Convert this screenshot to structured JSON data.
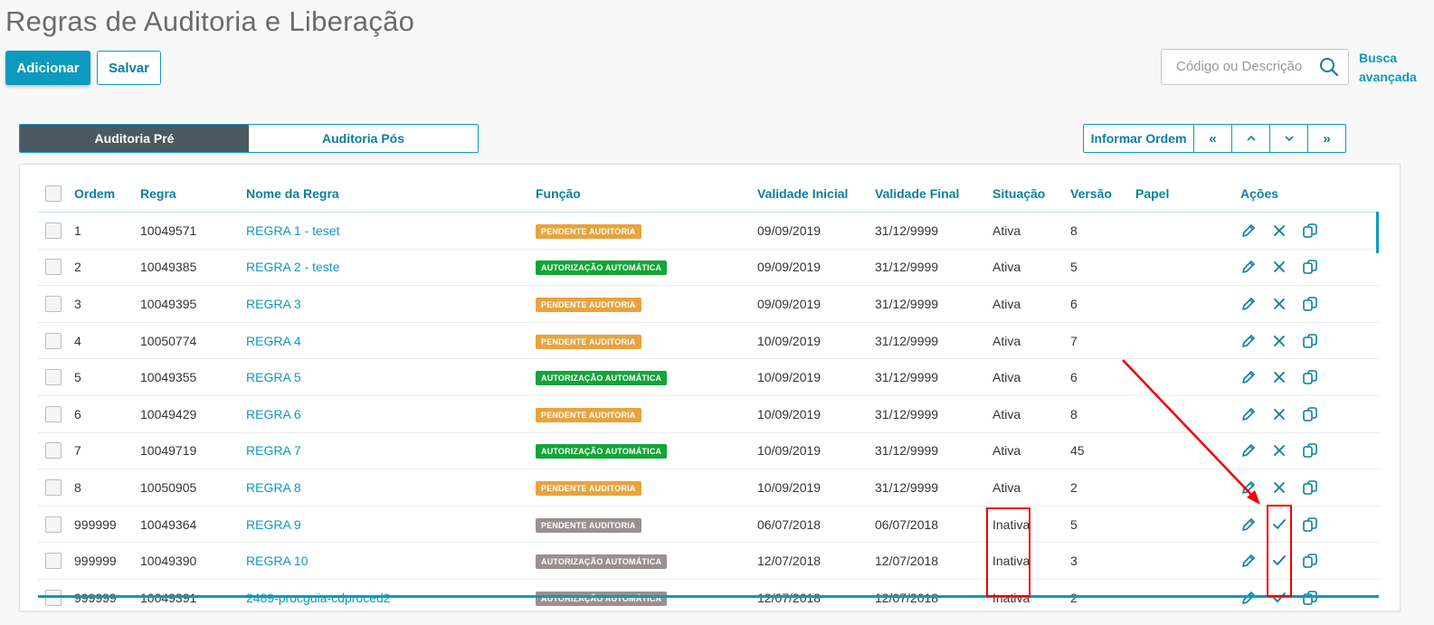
{
  "page": {
    "title": "Regras de Auditoria e Liberação"
  },
  "toolbar": {
    "add_label": "Adicionar",
    "save_label": "Salvar"
  },
  "search": {
    "placeholder": "Código ou Descrição",
    "icon": "search-icon",
    "advanced_label": "Busca avançada"
  },
  "tabs": [
    {
      "label": "Auditoria Pré",
      "active": true
    },
    {
      "label": "Auditoria Pós",
      "active": false
    }
  ],
  "order_controls": {
    "informar_label": "Informar Ordem",
    "first": "«",
    "up": "^",
    "down": "v",
    "last": "»"
  },
  "colors": {
    "accent": "#0c9abe",
    "tab_active": "#4b5a61",
    "badge_pending": "#e8a33d",
    "badge_auto": "#13a538",
    "badge_inactive": "#9a9090",
    "annotation": "#ee0000"
  },
  "table": {
    "headers": {
      "ordem": "Ordem",
      "regra": "Regra",
      "nome": "Nome da Regra",
      "funcao": "Função",
      "validade_inicial": "Validade Inicial",
      "validade_final": "Validade Final",
      "situacao": "Situação",
      "versao": "Versão",
      "papel": "Papel",
      "acoes": "Ações"
    },
    "rows": [
      {
        "ordem": "1",
        "regra": "10049571",
        "nome": "REGRA 1 - teset",
        "funcao": "PENDENTE AUDITORIA",
        "funcao_type": "pending",
        "validade_inicial": "09/09/2019",
        "validade_final": "31/12/9999",
        "situacao": "Ativa",
        "versao": "8",
        "papel": "",
        "actions": [
          "edit-icon",
          "close-icon",
          "copy-icon"
        ]
      },
      {
        "ordem": "2",
        "regra": "10049385",
        "nome": "REGRA 2 - teste",
        "funcao": "AUTORIZAÇÃO AUTOMÁTICA",
        "funcao_type": "auto",
        "validade_inicial": "09/09/2019",
        "validade_final": "31/12/9999",
        "situacao": "Ativa",
        "versao": "5",
        "papel": "",
        "actions": [
          "edit-icon",
          "close-icon",
          "copy-icon"
        ]
      },
      {
        "ordem": "3",
        "regra": "10049395",
        "nome": "REGRA 3",
        "funcao": "PENDENTE AUDITORIA",
        "funcao_type": "pending",
        "validade_inicial": "09/09/2019",
        "validade_final": "31/12/9999",
        "situacao": "Ativa",
        "versao": "6",
        "papel": "",
        "actions": [
          "edit-icon",
          "close-icon",
          "copy-icon"
        ]
      },
      {
        "ordem": "4",
        "regra": "10050774",
        "nome": "REGRA 4",
        "funcao": "PENDENTE AUDITORIA",
        "funcao_type": "pending",
        "validade_inicial": "10/09/2019",
        "validade_final": "31/12/9999",
        "situacao": "Ativa",
        "versao": "7",
        "papel": "",
        "actions": [
          "edit-icon",
          "close-icon",
          "copy-icon"
        ]
      },
      {
        "ordem": "5",
        "regra": "10049355",
        "nome": "REGRA 5",
        "funcao": "AUTORIZAÇÃO AUTOMÁTICA",
        "funcao_type": "auto",
        "validade_inicial": "10/09/2019",
        "validade_final": "31/12/9999",
        "situacao": "Ativa",
        "versao": "6",
        "papel": "",
        "actions": [
          "edit-icon",
          "close-icon",
          "copy-icon"
        ]
      },
      {
        "ordem": "6",
        "regra": "10049429",
        "nome": "REGRA 6",
        "funcao": "PENDENTE AUDITORIA",
        "funcao_type": "pending",
        "validade_inicial": "10/09/2019",
        "validade_final": "31/12/9999",
        "situacao": "Ativa",
        "versao": "8",
        "papel": "",
        "actions": [
          "edit-icon",
          "close-icon",
          "copy-icon"
        ]
      },
      {
        "ordem": "7",
        "regra": "10049719",
        "nome": "REGRA 7",
        "funcao": "AUTORIZAÇÃO AUTOMÁTICA",
        "funcao_type": "auto",
        "validade_inicial": "10/09/2019",
        "validade_final": "31/12/9999",
        "situacao": "Ativa",
        "versao": "45",
        "papel": "",
        "actions": [
          "edit-icon",
          "close-icon",
          "copy-icon"
        ]
      },
      {
        "ordem": "8",
        "regra": "10050905",
        "nome": "REGRA 8",
        "funcao": "PENDENTE AUDITORIA",
        "funcao_type": "pending",
        "validade_inicial": "10/09/2019",
        "validade_final": "31/12/9999",
        "situacao": "Ativa",
        "versao": "2",
        "papel": "",
        "actions": [
          "edit-icon",
          "close-icon",
          "copy-icon"
        ]
      },
      {
        "ordem": "999999",
        "regra": "10049364",
        "nome": "REGRA 9",
        "funcao": "PENDENTE AUDITORIA",
        "funcao_type": "inactive",
        "validade_inicial": "06/07/2018",
        "validade_final": "06/07/2018",
        "situacao": "Inativa",
        "versao": "5",
        "papel": "",
        "actions": [
          "edit-icon",
          "check-icon",
          "copy-icon"
        ]
      },
      {
        "ordem": "999999",
        "regra": "10049390",
        "nome": "REGRA 10",
        "funcao": "AUTORIZAÇÃO AUTOMÁTICA",
        "funcao_type": "inactive",
        "validade_inicial": "12/07/2018",
        "validade_final": "12/07/2018",
        "situacao": "Inativa",
        "versao": "3",
        "papel": "",
        "actions": [
          "edit-icon",
          "check-icon",
          "copy-icon"
        ]
      },
      {
        "ordem": "999999",
        "regra": "10049391",
        "nome": "2489-procguia-cdproced2",
        "funcao": "AUTORIZAÇÃO AUTOMÁTICA",
        "funcao_type": "inactive",
        "validade_inicial": "12/07/2018",
        "validade_final": "12/07/2018",
        "situacao": "Inativa",
        "versao": "2",
        "papel": "",
        "actions": [
          "edit-icon",
          "check-icon",
          "copy-icon"
        ]
      }
    ]
  }
}
